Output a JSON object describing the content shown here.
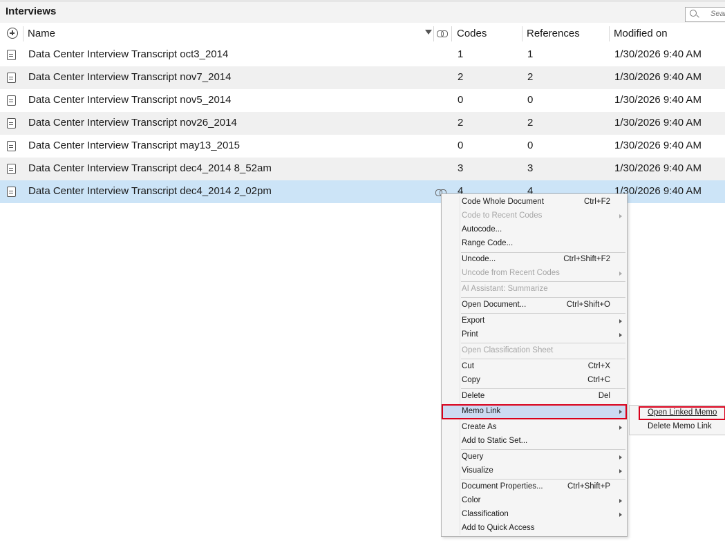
{
  "window": {
    "title": "Interviews",
    "search_placeholder": "Search"
  },
  "columns": {
    "name": "Name",
    "codes": "Codes",
    "references": "References",
    "modified": "Modified on"
  },
  "rows": [
    {
      "name": "Data Center Interview Transcript oct3_2014",
      "codes": "1",
      "references": "1",
      "modified": "1/30/2026 9:40 AM"
    },
    {
      "name": "Data Center Interview Transcript nov7_2014",
      "codes": "2",
      "references": "2",
      "modified": "1/30/2026 9:40 AM"
    },
    {
      "name": "Data Center Interview Transcript nov5_2014",
      "codes": "0",
      "references": "0",
      "modified": "1/30/2026 9:40 AM"
    },
    {
      "name": "Data Center Interview Transcript nov26_2014",
      "codes": "2",
      "references": "2",
      "modified": "1/30/2026 9:40 AM"
    },
    {
      "name": "Data Center Interview Transcript may13_2015",
      "codes": "0",
      "references": "0",
      "modified": "1/30/2026 9:40 AM"
    },
    {
      "name": "Data Center Interview Transcript dec4_2014 8_52am",
      "codes": "3",
      "references": "3",
      "modified": "1/30/2026 9:40 AM"
    },
    {
      "name": "Data Center Interview Transcript dec4_2014 2_02pm",
      "codes": "4",
      "references": "4",
      "modified": "1/30/2026 9:40 AM"
    }
  ],
  "context_menu": {
    "code_whole_document": {
      "label": "Code Whole Document",
      "shortcut": "Ctrl+F2"
    },
    "code_recent": {
      "label": "Code to Recent Codes"
    },
    "autocode": {
      "label": "Autocode..."
    },
    "range_code": {
      "label": "Range Code..."
    },
    "uncode": {
      "label": "Uncode...",
      "shortcut": "Ctrl+Shift+F2"
    },
    "uncode_recent": {
      "label": "Uncode from Recent Codes"
    },
    "ai_summarize": {
      "label": "AI Assistant: Summarize"
    },
    "open_document": {
      "label": "Open Document...",
      "shortcut": "Ctrl+Shift+O"
    },
    "export": {
      "label": "Export"
    },
    "print": {
      "label": "Print"
    },
    "open_classification": {
      "label": "Open Classification Sheet"
    },
    "cut": {
      "label": "Cut",
      "shortcut": "Ctrl+X"
    },
    "copy": {
      "label": "Copy",
      "shortcut": "Ctrl+C"
    },
    "delete": {
      "label": "Delete",
      "shortcut": "Del"
    },
    "memo_link": {
      "label": "Memo Link"
    },
    "create_as": {
      "label": "Create As"
    },
    "add_static_set": {
      "label": "Add to Static Set..."
    },
    "query": {
      "label": "Query"
    },
    "visualize": {
      "label": "Visualize"
    },
    "document_properties": {
      "label": "Document Properties...",
      "shortcut": "Ctrl+Shift+P"
    },
    "color": {
      "label": "Color"
    },
    "classification": {
      "label": "Classification"
    },
    "add_quick_access": {
      "label": "Add to Quick Access"
    }
  },
  "submenu": {
    "open_linked_memo": "Open Linked Memo",
    "delete_memo_link": "Delete Memo Link"
  },
  "colors": {
    "selected_row": "#cce4f7",
    "alt_row": "#f0f0f0",
    "highlight_box": "#d9001b",
    "menu_hover": "#ccdbf2"
  }
}
